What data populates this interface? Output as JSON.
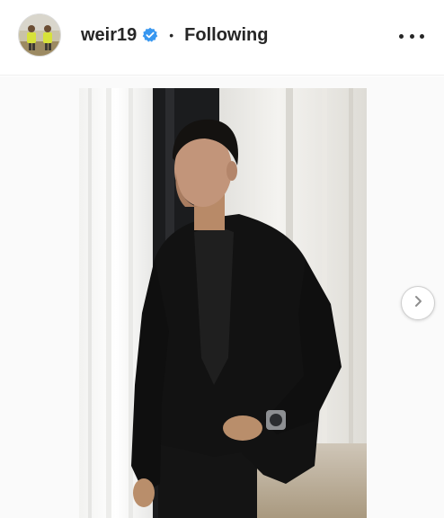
{
  "post_header": {
    "username": "weir19",
    "verified_icon": "verified-badge-icon",
    "separator": "•",
    "follow_status": "Following",
    "more_icon": "more-options-icon"
  },
  "media": {
    "next_icon": "chevron-right-icon"
  },
  "colors": {
    "text": "#262626",
    "verified_blue": "#3897f0",
    "border": "#efefef"
  }
}
